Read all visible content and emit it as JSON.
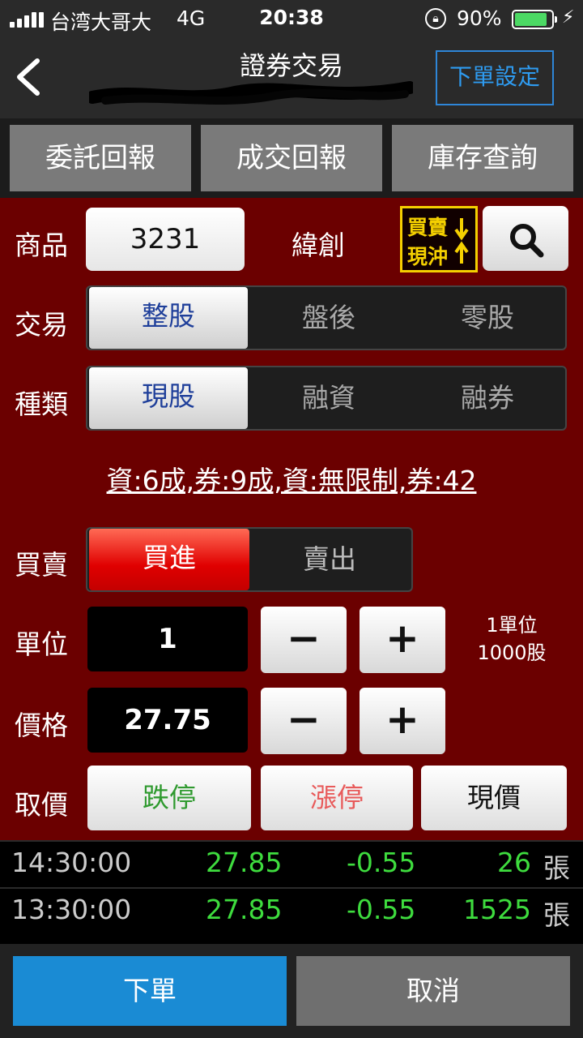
{
  "status_bar": {
    "carrier": "台湾大哥大",
    "network": "4G",
    "time": "20:38",
    "battery": "90%"
  },
  "nav": {
    "title": "證券交易",
    "order_settings": "下單設定"
  },
  "query_tabs": [
    "委託回報",
    "成交回報",
    "庫存查詢"
  ],
  "form": {
    "product_label": "商品",
    "stock_code": "3231",
    "stock_name": "緯創",
    "day_trade_badge": {
      "line1": "買賣",
      "line2": "現沖"
    },
    "trade_label": "交易",
    "trade_options": [
      "整股",
      "盤後",
      "零股"
    ],
    "trade_selected": "整股",
    "type_label": "種類",
    "type_options": [
      "現股",
      "融資",
      "融券"
    ],
    "type_selected": "現股",
    "margin_info": "資:6成,券:9成,資:無限制,券:42",
    "side_label": "買賣",
    "side_options": [
      "買進",
      "賣出"
    ],
    "side_selected": "買進",
    "unit_label": "單位",
    "unit_value": "1",
    "unit_note_line1": "1單位",
    "unit_note_line2": "1000股",
    "price_label": "價格",
    "price_value": "27.75",
    "quick_price_label": "取價",
    "quick_price": {
      "limit_down": "跌停",
      "limit_up": "漲停",
      "current": "現價"
    },
    "minus": "−",
    "plus": "+"
  },
  "ticks": [
    {
      "time": "14:30:00",
      "price": "27.85",
      "change": "-0.55",
      "volume": "26",
      "unit": "張"
    },
    {
      "time": "13:30:00",
      "price": "27.85",
      "change": "-0.55",
      "volume": "1525",
      "unit": "張"
    }
  ],
  "actions": {
    "submit": "下單",
    "cancel": "取消"
  },
  "colors": {
    "panel": "#6b0000",
    "accent_blue": "#1a8bd4",
    "buy_red": "#e00000",
    "tick_green": "#3edc3e",
    "limit_down_green": "#2f9a2f",
    "limit_up_red": "#e85a5a",
    "badge_yellow": "#f5d000"
  }
}
